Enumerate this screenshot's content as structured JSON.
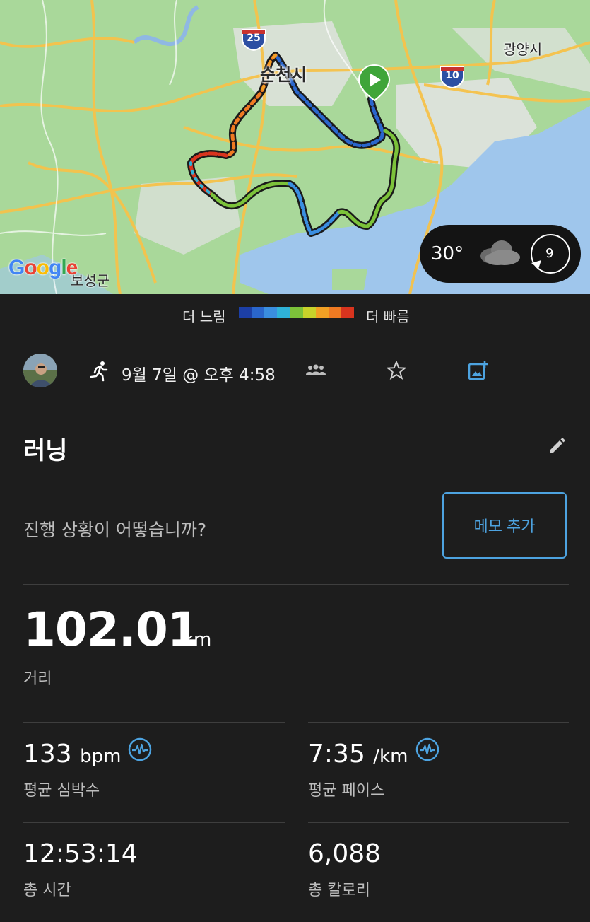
{
  "map": {
    "city_main": "순천시",
    "city_east": "광양시",
    "region_bottom": "보성군",
    "highway_25": "25",
    "highway_10": "10",
    "logo": "Google",
    "colors": {
      "land": "#a9d89a",
      "water": "#9fc6ec",
      "urban": "#e4e4e4",
      "road": "#f6c24a"
    }
  },
  "weather": {
    "temperature": "30°",
    "icon": "cloud-icon",
    "wind": "9"
  },
  "legend": {
    "slow_label": "더 느림",
    "fast_label": "더 빠름",
    "colors": [
      "#1c3fa6",
      "#2a66cc",
      "#3a8ee0",
      "#2fb2d8",
      "#7cc23a",
      "#c8d22a",
      "#f2a024",
      "#ef7a22",
      "#d8341e"
    ]
  },
  "activity": {
    "date": "9월 7일 @ 오후 4:58",
    "type_icon": "running-icon",
    "title": "러닝",
    "prompt": "진행 상황이 어떻습니까?",
    "memo_button": "메모 추가"
  },
  "stats": {
    "distance": {
      "value": "102.01",
      "unit": "km",
      "label": "거리"
    },
    "avg_hr": {
      "value": "133",
      "unit": "bpm",
      "label": "평균 심박수"
    },
    "avg_pace": {
      "value": "7:35",
      "unit": "/km",
      "label": "평균 페이스"
    },
    "total_time": {
      "value": "12:53:14",
      "label": "총 시간"
    },
    "total_calories": {
      "value": "6,088",
      "label": "총 칼로리"
    }
  },
  "accent_color": "#4da3e0"
}
